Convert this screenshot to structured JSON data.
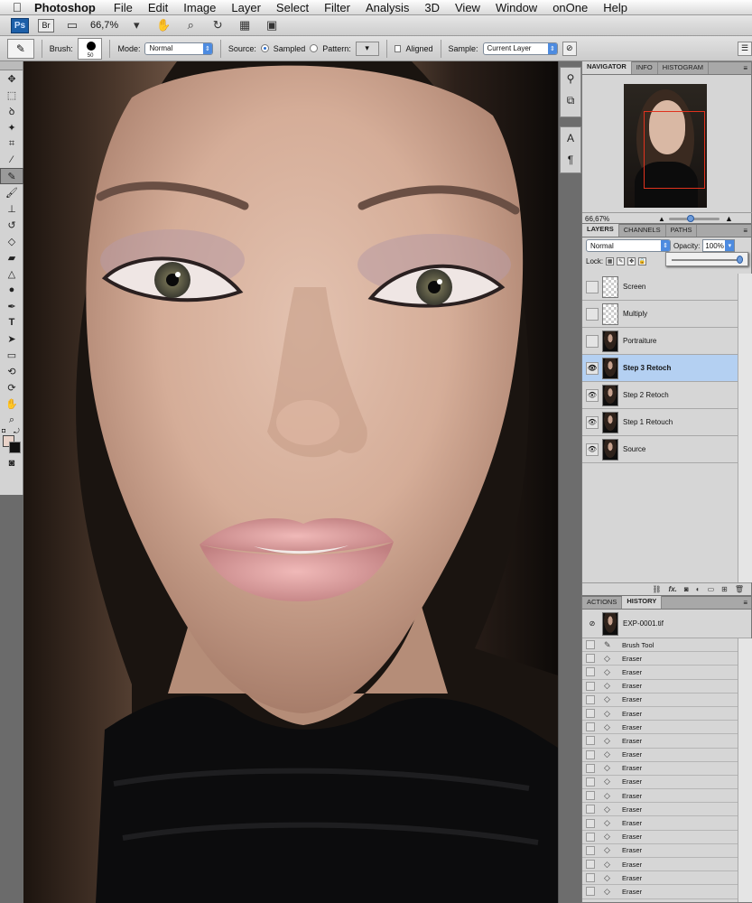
{
  "menubar": {
    "apple_icon": "apple-icon",
    "app": "Photoshop",
    "items": [
      "File",
      "Edit",
      "Image",
      "Layer",
      "Select",
      "Filter",
      "Analysis",
      "3D",
      "View",
      "Window",
      "onOne",
      "Help"
    ]
  },
  "appbar": {
    "ps": "Ps",
    "br": "Br",
    "zoom": "66,7%",
    "zoom_arrow": "▾"
  },
  "options": {
    "brush_label": "Brush:",
    "brush_size": "50",
    "mode_label": "Mode:",
    "mode_value": "Normal",
    "source_label": "Source:",
    "sampled": "Sampled",
    "pattern": "Pattern:",
    "aligned": "Aligned",
    "sample_label": "Sample:",
    "sample_value": "Current Layer"
  },
  "navigator": {
    "tabs": [
      "NAVIGATOR",
      "INFO",
      "HISTOGRAM"
    ],
    "zoom": "66,67%",
    "box_color": "#e0321e"
  },
  "layers": {
    "tabs": [
      "LAYERS",
      "CHANNELS",
      "PATHS"
    ],
    "blend": "Normal",
    "opacity_label": "Opacity:",
    "opacity": "100%",
    "opacity_level": 1.0,
    "lock_label": "Lock:",
    "items": [
      {
        "name": "Screen",
        "visible": false,
        "thumb": "transparent",
        "selected": false
      },
      {
        "name": "Multiply",
        "visible": false,
        "thumb": "transparent",
        "selected": false
      },
      {
        "name": "Portraiture",
        "visible": false,
        "thumb": "photo",
        "selected": false
      },
      {
        "name": "Step 3 Retoch",
        "visible": true,
        "thumb": "photo",
        "selected": true
      },
      {
        "name": "Step 2 Retoch",
        "visible": true,
        "thumb": "photo",
        "selected": false
      },
      {
        "name": "Step 1 Retouch",
        "visible": true,
        "thumb": "photo",
        "selected": false
      },
      {
        "name": "Source",
        "visible": true,
        "thumb": "photo",
        "selected": false
      }
    ],
    "footer_icons": [
      "link-icon",
      "fx-icon",
      "mask-icon",
      "adjustment-icon",
      "group-icon",
      "new-layer-icon",
      "trash-icon"
    ],
    "fx": "fx."
  },
  "history": {
    "tabs": [
      "ACTIONS",
      "HISTORY"
    ],
    "snapshot": "EXP-0001.tif",
    "items": [
      "Brush Tool",
      "Eraser",
      "Eraser",
      "Eraser",
      "Eraser",
      "Eraser",
      "Eraser",
      "Eraser",
      "Eraser",
      "Eraser",
      "Eraser",
      "Eraser",
      "Eraser",
      "Eraser",
      "Eraser",
      "Eraser",
      "Eraser",
      "Eraser",
      "Eraser"
    ]
  },
  "colors": {
    "foreground": "#e9d3c9",
    "background": "#111111",
    "selection": "#b4d0f2"
  }
}
